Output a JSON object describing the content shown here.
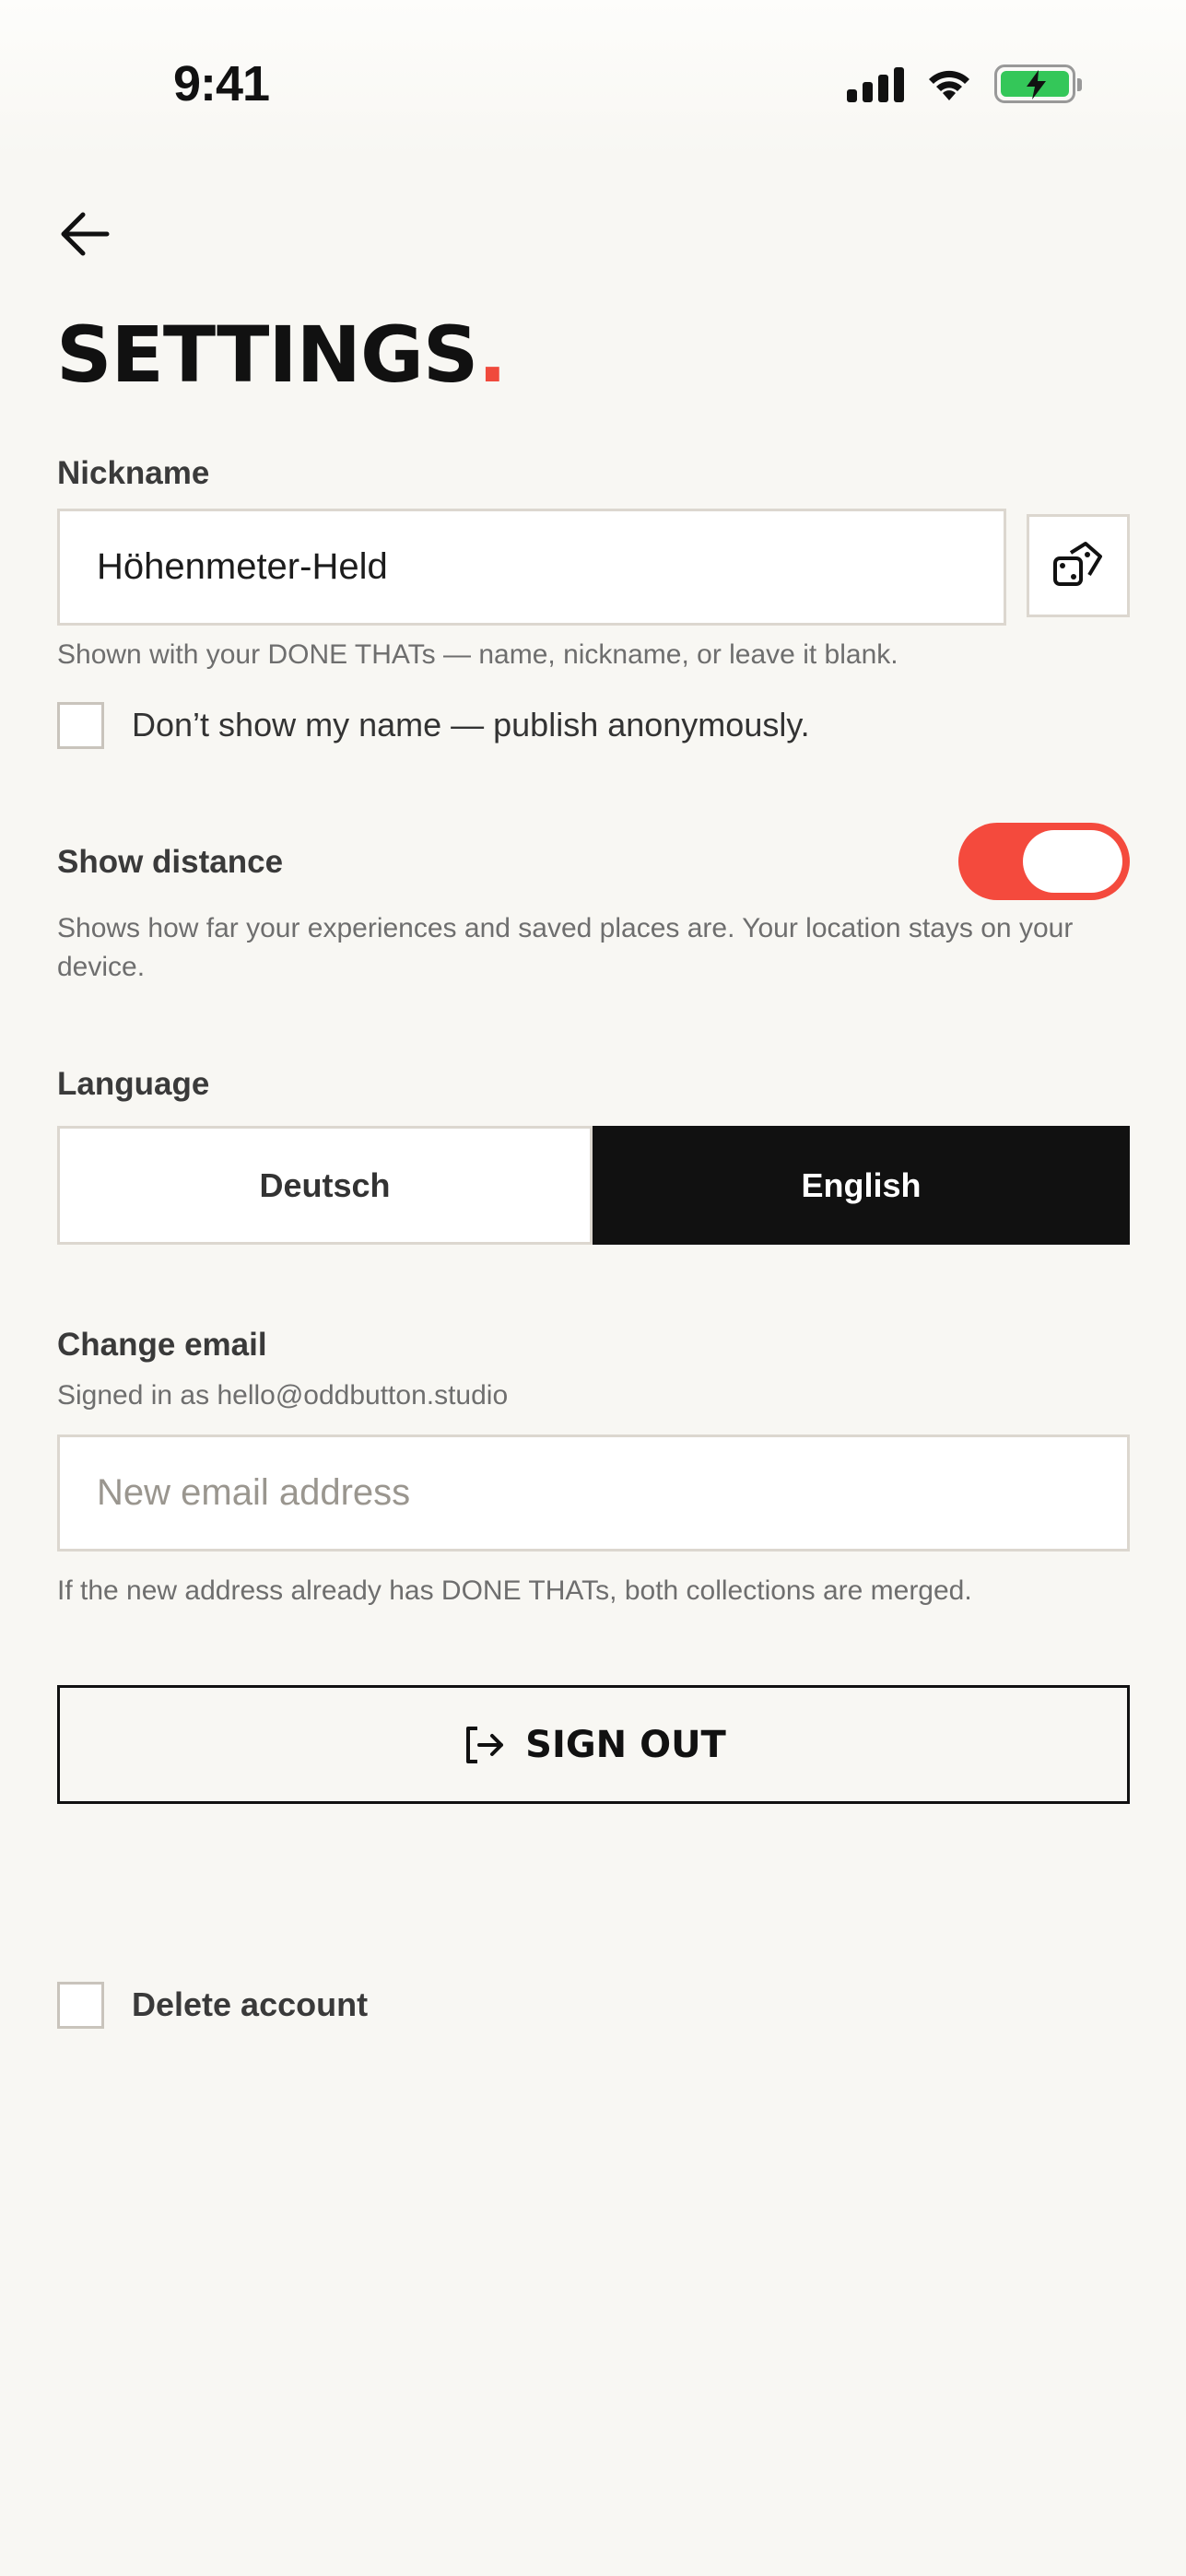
{
  "status_bar": {
    "time": "9:41"
  },
  "header": {
    "title": "SETTINGS",
    "title_dot": "."
  },
  "nickname": {
    "label": "Nickname",
    "value": "Höhenmeter-Held",
    "hint": "Shown with your DONE THATs — name, nickname, or leave it blank.",
    "anonymous_label": "Don’t show my name — publish anonymously.",
    "anonymous_checked": false
  },
  "distance": {
    "label": "Show distance",
    "hint": "Shows how far your experiences and saved places are. Your location stays on your device.",
    "enabled": true
  },
  "language": {
    "label": "Language",
    "options": [
      "Deutsch",
      "English"
    ],
    "selected": "English"
  },
  "email": {
    "label": "Change email",
    "signed_in": "Signed in as hello@oddbutton.studio",
    "placeholder": "New email address",
    "hint": "If the new address already has DONE THATs, both collections are merged."
  },
  "actions": {
    "sign_out": "SIGN OUT",
    "delete_account": "Delete account"
  },
  "colors": {
    "accent": "#f44a3d",
    "background": "#f8f7f3",
    "dark": "#111111"
  }
}
